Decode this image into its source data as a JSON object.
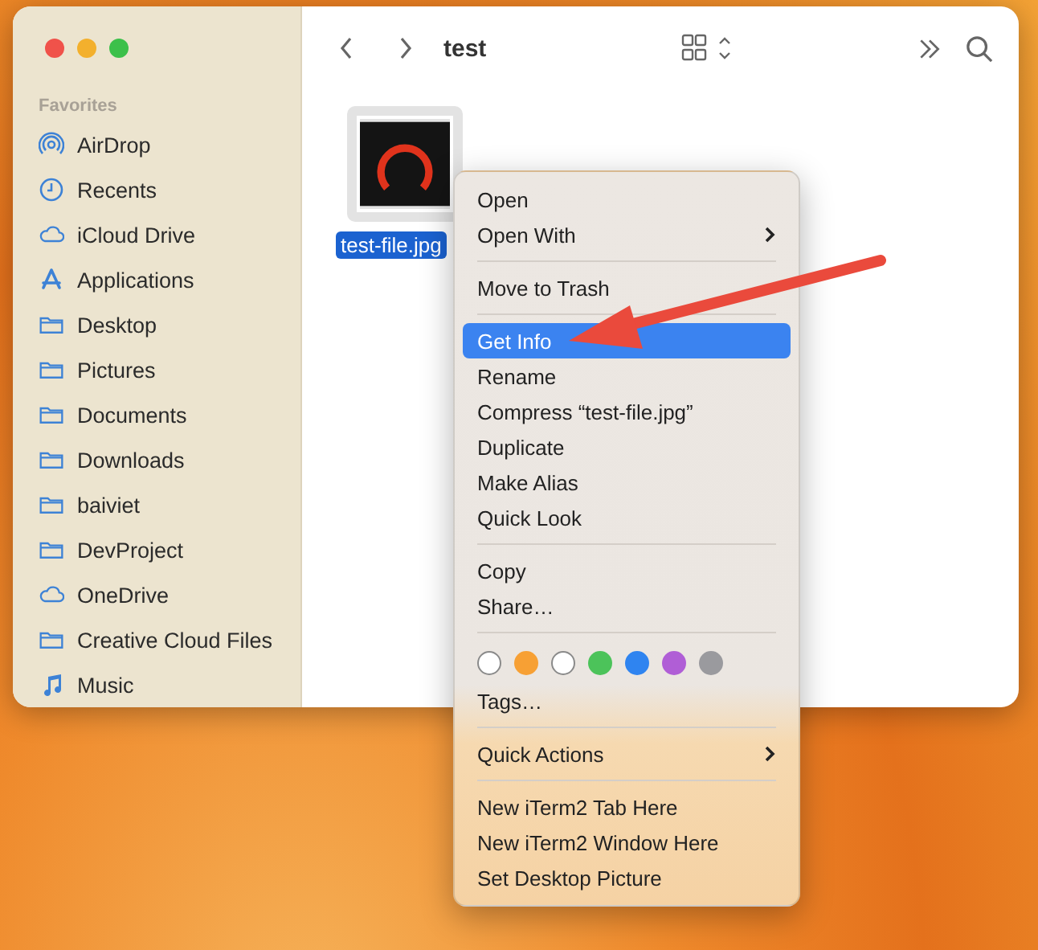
{
  "window": {
    "title": "test"
  },
  "sidebar": {
    "section": "Favorites",
    "items": [
      {
        "label": "AirDrop",
        "kind": "airdrop"
      },
      {
        "label": "Recents",
        "kind": "clock"
      },
      {
        "label": "iCloud Drive",
        "kind": "cloud"
      },
      {
        "label": "Applications",
        "kind": "apps"
      },
      {
        "label": "Desktop",
        "kind": "folder"
      },
      {
        "label": "Pictures",
        "kind": "folder"
      },
      {
        "label": "Documents",
        "kind": "folder"
      },
      {
        "label": "Downloads",
        "kind": "folder"
      },
      {
        "label": "baiviet",
        "kind": "folder"
      },
      {
        "label": "DevProject",
        "kind": "folder"
      },
      {
        "label": "OneDrive",
        "kind": "cloud"
      },
      {
        "label": "Creative Cloud Files",
        "kind": "folder"
      },
      {
        "label": "Music",
        "kind": "music"
      }
    ]
  },
  "files": [
    {
      "name": "test-file.jpg",
      "selected": true
    }
  ],
  "context_menu": {
    "sections": [
      {
        "kind": "items",
        "items": [
          {
            "label": "Open",
            "submenu": false,
            "selected": false
          },
          {
            "label": "Open With",
            "submenu": true,
            "selected": false
          }
        ]
      },
      {
        "kind": "items",
        "items": [
          {
            "label": "Move to Trash",
            "submenu": false,
            "selected": false
          }
        ]
      },
      {
        "kind": "items",
        "items": [
          {
            "label": "Get Info",
            "submenu": false,
            "selected": true
          },
          {
            "label": "Rename",
            "submenu": false,
            "selected": false
          },
          {
            "label": "Compress “test-file.jpg”",
            "submenu": false,
            "selected": false
          },
          {
            "label": "Duplicate",
            "submenu": false,
            "selected": false
          },
          {
            "label": "Make Alias",
            "submenu": false,
            "selected": false
          },
          {
            "label": "Quick Look",
            "submenu": false,
            "selected": false
          }
        ]
      },
      {
        "kind": "items",
        "items": [
          {
            "label": "Copy",
            "submenu": false,
            "selected": false
          },
          {
            "label": "Share…",
            "submenu": false,
            "selected": false
          }
        ]
      },
      {
        "kind": "tags",
        "colors": [
          {
            "color": "#ffffff"
          },
          {
            "color": "#f7a034"
          },
          {
            "color": "#ffffff"
          },
          {
            "color": "#4cc35a"
          },
          {
            "color": "#2f84f0"
          },
          {
            "color": "#b05ed6"
          },
          {
            "color": "#9a9a9e"
          }
        ],
        "label": "Tags…"
      },
      {
        "kind": "items",
        "items": [
          {
            "label": "Quick Actions",
            "submenu": true,
            "selected": false
          }
        ]
      },
      {
        "kind": "items",
        "items": [
          {
            "label": "New iTerm2 Tab Here",
            "submenu": false,
            "selected": false
          },
          {
            "label": "New iTerm2 Window Here",
            "submenu": false,
            "selected": false
          },
          {
            "label": "Set Desktop Picture",
            "submenu": false,
            "selected": false
          }
        ]
      }
    ]
  }
}
